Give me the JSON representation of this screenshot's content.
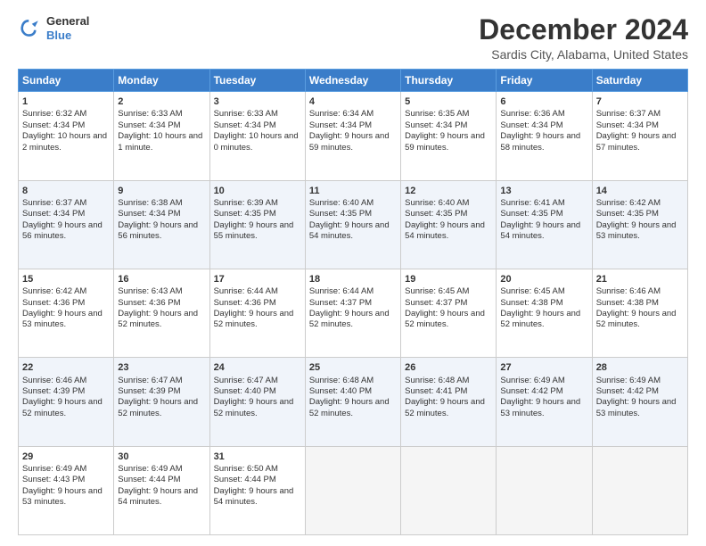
{
  "header": {
    "logo_line1": "General",
    "logo_line2": "Blue",
    "title": "December 2024",
    "subtitle": "Sardis City, Alabama, United States"
  },
  "columns": [
    "Sunday",
    "Monday",
    "Tuesday",
    "Wednesday",
    "Thursday",
    "Friday",
    "Saturday"
  ],
  "weeks": [
    [
      {
        "day": "1",
        "sr": "6:32 AM",
        "ss": "4:34 PM",
        "dh": "10 hours and 2 minutes."
      },
      {
        "day": "2",
        "sr": "6:33 AM",
        "ss": "4:34 PM",
        "dh": "10 hours and 1 minute."
      },
      {
        "day": "3",
        "sr": "6:33 AM",
        "ss": "4:34 PM",
        "dh": "10 hours and 0 minutes."
      },
      {
        "day": "4",
        "sr": "6:34 AM",
        "ss": "4:34 PM",
        "dh": "9 hours and 59 minutes."
      },
      {
        "day": "5",
        "sr": "6:35 AM",
        "ss": "4:34 PM",
        "dh": "9 hours and 59 minutes."
      },
      {
        "day": "6",
        "sr": "6:36 AM",
        "ss": "4:34 PM",
        "dh": "9 hours and 58 minutes."
      },
      {
        "day": "7",
        "sr": "6:37 AM",
        "ss": "4:34 PM",
        "dh": "9 hours and 57 minutes."
      }
    ],
    [
      {
        "day": "8",
        "sr": "6:37 AM",
        "ss": "4:34 PM",
        "dh": "9 hours and 56 minutes."
      },
      {
        "day": "9",
        "sr": "6:38 AM",
        "ss": "4:34 PM",
        "dh": "9 hours and 56 minutes."
      },
      {
        "day": "10",
        "sr": "6:39 AM",
        "ss": "4:35 PM",
        "dh": "9 hours and 55 minutes."
      },
      {
        "day": "11",
        "sr": "6:40 AM",
        "ss": "4:35 PM",
        "dh": "9 hours and 54 minutes."
      },
      {
        "day": "12",
        "sr": "6:40 AM",
        "ss": "4:35 PM",
        "dh": "9 hours and 54 minutes."
      },
      {
        "day": "13",
        "sr": "6:41 AM",
        "ss": "4:35 PM",
        "dh": "9 hours and 54 minutes."
      },
      {
        "day": "14",
        "sr": "6:42 AM",
        "ss": "4:35 PM",
        "dh": "9 hours and 53 minutes."
      }
    ],
    [
      {
        "day": "15",
        "sr": "6:42 AM",
        "ss": "4:36 PM",
        "dh": "9 hours and 53 minutes."
      },
      {
        "day": "16",
        "sr": "6:43 AM",
        "ss": "4:36 PM",
        "dh": "9 hours and 52 minutes."
      },
      {
        "day": "17",
        "sr": "6:44 AM",
        "ss": "4:36 PM",
        "dh": "9 hours and 52 minutes."
      },
      {
        "day": "18",
        "sr": "6:44 AM",
        "ss": "4:37 PM",
        "dh": "9 hours and 52 minutes."
      },
      {
        "day": "19",
        "sr": "6:45 AM",
        "ss": "4:37 PM",
        "dh": "9 hours and 52 minutes."
      },
      {
        "day": "20",
        "sr": "6:45 AM",
        "ss": "4:38 PM",
        "dh": "9 hours and 52 minutes."
      },
      {
        "day": "21",
        "sr": "6:46 AM",
        "ss": "4:38 PM",
        "dh": "9 hours and 52 minutes."
      }
    ],
    [
      {
        "day": "22",
        "sr": "6:46 AM",
        "ss": "4:39 PM",
        "dh": "9 hours and 52 minutes."
      },
      {
        "day": "23",
        "sr": "6:47 AM",
        "ss": "4:39 PM",
        "dh": "9 hours and 52 minutes."
      },
      {
        "day": "24",
        "sr": "6:47 AM",
        "ss": "4:40 PM",
        "dh": "9 hours and 52 minutes."
      },
      {
        "day": "25",
        "sr": "6:48 AM",
        "ss": "4:40 PM",
        "dh": "9 hours and 52 minutes."
      },
      {
        "day": "26",
        "sr": "6:48 AM",
        "ss": "4:41 PM",
        "dh": "9 hours and 52 minutes."
      },
      {
        "day": "27",
        "sr": "6:49 AM",
        "ss": "4:42 PM",
        "dh": "9 hours and 53 minutes."
      },
      {
        "day": "28",
        "sr": "6:49 AM",
        "ss": "4:42 PM",
        "dh": "9 hours and 53 minutes."
      }
    ],
    [
      {
        "day": "29",
        "sr": "6:49 AM",
        "ss": "4:43 PM",
        "dh": "9 hours and 53 minutes."
      },
      {
        "day": "30",
        "sr": "6:49 AM",
        "ss": "4:44 PM",
        "dh": "9 hours and 54 minutes."
      },
      {
        "day": "31",
        "sr": "6:50 AM",
        "ss": "4:44 PM",
        "dh": "9 hours and 54 minutes."
      },
      null,
      null,
      null,
      null
    ]
  ]
}
